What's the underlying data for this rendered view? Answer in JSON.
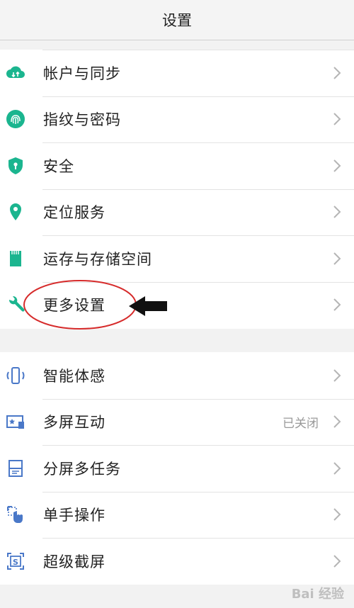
{
  "header": {
    "title": "设置"
  },
  "colors": {
    "teal": "#1bb58f",
    "blue": "#4a78c8",
    "annotation_red": "#d62b2b"
  },
  "group1": [
    {
      "label": "帐户与同步",
      "icon": "cloud-sync-icon"
    },
    {
      "label": "指纹与密码",
      "icon": "fingerprint-icon"
    },
    {
      "label": "安全",
      "icon": "shield-icon"
    },
    {
      "label": "定位服务",
      "icon": "location-pin-icon"
    },
    {
      "label": "运存与存储空间",
      "icon": "sd-card-icon"
    },
    {
      "label": "更多设置",
      "icon": "wrench-icon"
    }
  ],
  "group2": [
    {
      "label": "智能体感",
      "icon": "phone-motion-icon"
    },
    {
      "label": "多屏互动",
      "icon": "cast-screen-icon",
      "status": "已关闭"
    },
    {
      "label": "分屏多任务",
      "icon": "split-screen-icon"
    },
    {
      "label": "单手操作",
      "icon": "one-hand-icon"
    },
    {
      "label": "超级截屏",
      "icon": "screenshot-icon"
    }
  ],
  "watermark": "Bai 经验"
}
